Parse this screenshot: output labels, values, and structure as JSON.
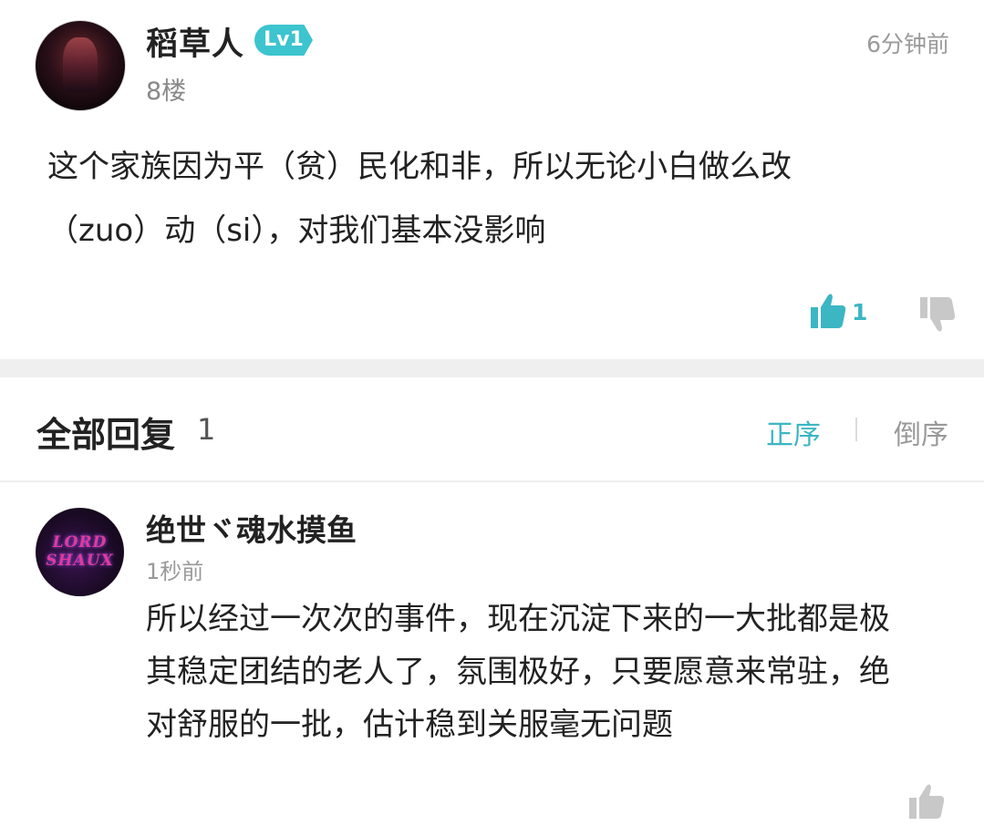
{
  "post": {
    "username": "稻草人",
    "level": "Lv1",
    "floor": "8楼",
    "time": "6分钟前",
    "content_line1": "这个家族因为平（贫）民化和非，所以无论小白做么改",
    "content_line2": "（zuo）动（si），对我们基本没影响",
    "like_count": "1",
    "colors": {
      "accent": "#3cb6c3",
      "level_badge": "#3cc4cf"
    }
  },
  "replies_header": {
    "title": "全部回复",
    "count": "1",
    "sort_asc": "正序",
    "sort_desc": "倒序"
  },
  "reply": {
    "username": "绝世ヾ魂水摸鱼",
    "time": "1秒前",
    "content_line1": "所以经过一次次的事件，现在沉淀下来的一大批都是极",
    "content_line2": "其稳定团结的老人了，氛围极好，只要愿意来常驻，绝",
    "content_line3": "对舒服的一批，估计稳到关服毫无问题",
    "avatar_text_line1": "LORD",
    "avatar_text_line2": "SHAUX"
  }
}
